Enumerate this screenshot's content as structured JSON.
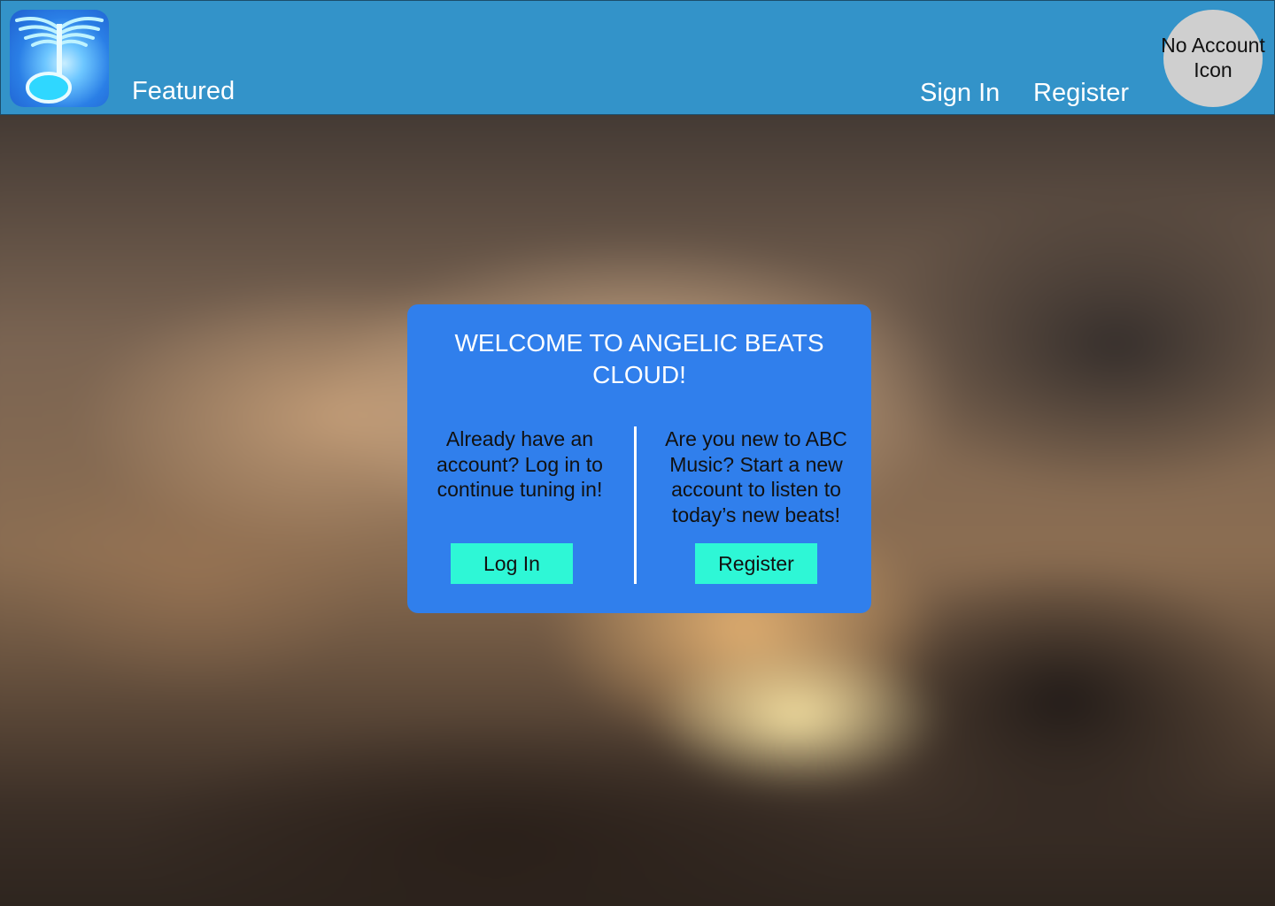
{
  "header": {
    "logo_icon": "angelic-beats-logo-icon",
    "nav_featured": "Featured",
    "nav_sign_in": "Sign In",
    "nav_register": "Register",
    "account_icon_label": "No Account\nIcon"
  },
  "dialog": {
    "title": "WELCOME TO ANGELIC BEATS CLOUD!",
    "left_text": "Already have an account? Log in to continue tuning in!",
    "right_text": "Are you new to ABC Music? Start a new account to listen to today’s new beats!",
    "login_button": "Log In",
    "register_button": "Register"
  },
  "colors": {
    "header_bg": "#3393c9",
    "dialog_bg": "#307fec",
    "button_bg": "#2ef7d6",
    "account_icon_bg": "#cfcfcf"
  }
}
